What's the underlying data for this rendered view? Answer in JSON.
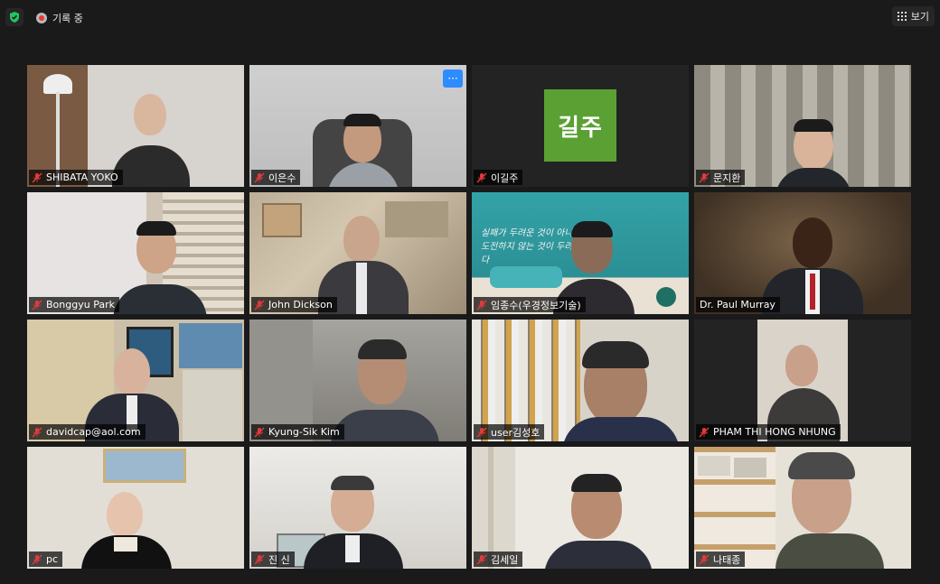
{
  "topbar": {
    "recording_label": "기록 중",
    "view_label": "보기"
  },
  "participants": [
    {
      "name": "SHIBATA YOKO"
    },
    {
      "name": "이은수"
    },
    {
      "name": "이길주",
      "avatar_text": "길주",
      "avatar_color": "#5aa033"
    },
    {
      "name": "문지환"
    },
    {
      "name": "Bonggyu Park"
    },
    {
      "name": "John Dickson"
    },
    {
      "name": "임종수(우경정보기술)",
      "background_text": "실패가 두려운 것이 아니라\n도전하지 않는 것이 두려운 것이다"
    },
    {
      "name": "Dr. Paul Murray",
      "active_speaker": true
    },
    {
      "name": "davidcap@aol.com"
    },
    {
      "name": "Kyung-Sik Kim"
    },
    {
      "name": "user김성호"
    },
    {
      "name": "PHAM THI HONG NHUNG"
    },
    {
      "name": "pc"
    },
    {
      "name": "진 신"
    },
    {
      "name": "김세일"
    },
    {
      "name": "나태종"
    }
  ],
  "colors": {
    "background": "#1a1a1a",
    "active_speaker_border": "#dde256",
    "muted_icon": "#e5393b",
    "more_button": "#2d8cff"
  }
}
